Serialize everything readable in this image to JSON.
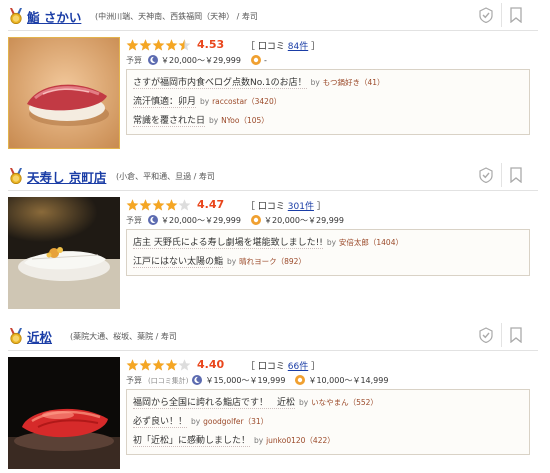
{
  "icons": {
    "medal": "gold-medal-icon",
    "visited": "check-circle-icon",
    "bookmark": "bookmark-icon",
    "lunch": "sun-icon",
    "dinner": "moon-icon"
  },
  "colors": {
    "link": "#1a3da6",
    "score": "#e9461c",
    "star": "#f5a623"
  },
  "restaurants": [
    {
      "name": "鮨 さかい",
      "location": "(中洲川端、天神南、西鉄福岡（天神） / 寿司",
      "rating": 4.53,
      "stars": 4.5,
      "review_label": "口コミ",
      "review_count": "84件",
      "budget_label": "予算",
      "budget_note": "",
      "dinner_budget": "￥20,000～￥29,999",
      "lunch_budget": "-",
      "quotes": [
        {
          "text": "さすが福岡市内食べログ点数No.1のお店！",
          "by": "by",
          "user": "もつ鍋好き（41）"
        },
        {
          "text": "流汗慎適：卯月",
          "by": "by",
          "user": "raccostar（3420）"
        },
        {
          "text": "常識を覆された日",
          "by": "by",
          "user": "NYoo（105）"
        }
      ]
    },
    {
      "name": "天寿し 京町店",
      "location": "(小倉、平和通、旦過 / 寿司",
      "rating": 4.47,
      "stars": 4.0,
      "review_label": "口コミ",
      "review_count": "301件",
      "budget_label": "予算",
      "budget_note": "",
      "dinner_budget": "￥20,000～￥29,999",
      "lunch_budget": "￥20,000～￥29,999",
      "quotes": [
        {
          "text": "店主 天野氏による寿し劇場を堪能致しました!!",
          "by": "by",
          "user": "安倍太郎（1404）"
        },
        {
          "text": "江戸にはない太陽の鮨",
          "by": "by",
          "user": "晴れヨーク（892）"
        }
      ]
    },
    {
      "name": "近松",
      "location": "(薬院大通、桜坂、薬院 / 寿司",
      "rating": 4.4,
      "stars": 4.0,
      "review_label": "口コミ",
      "review_count": "66件",
      "budget_label": "予算",
      "budget_note": "(口コミ集計)",
      "dinner_budget": "￥15,000～￥19,999",
      "lunch_budget": "￥10,000～￥14,999",
      "quotes": [
        {
          "text": "福岡から全国に誇れる鮨店です！　近松",
          "by": "by",
          "user": "いなやまん（552）"
        },
        {
          "text": "必ず良い！！",
          "by": "by",
          "user": "goodgolfer（31）"
        },
        {
          "text": "初「近松」に感動しました！",
          "by": "by",
          "user": "junko0120（422）"
        }
      ]
    }
  ]
}
